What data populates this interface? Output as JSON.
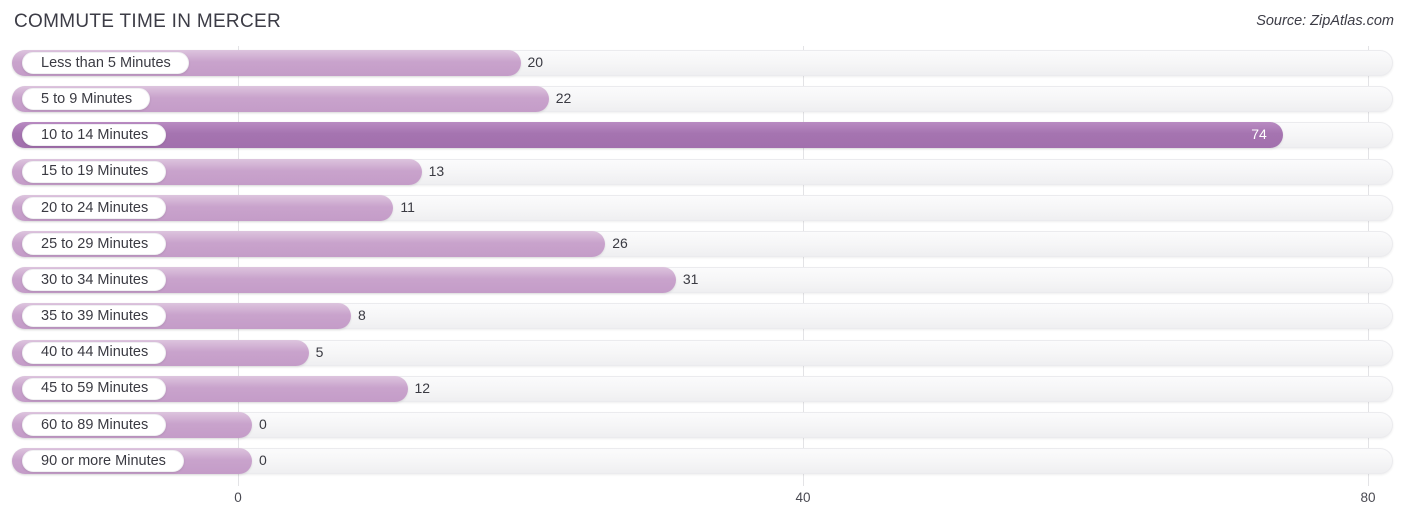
{
  "header": {
    "title": "COMMUTE TIME IN MERCER",
    "source": "Source: ZipAtlas.com"
  },
  "axis": {
    "ticks": [
      "0",
      "40",
      "80"
    ]
  },
  "chart_data": {
    "type": "bar",
    "orientation": "horizontal",
    "title": "COMMUTE TIME IN MERCER",
    "subtitle": "Source: ZipAtlas.com",
    "xlabel": "",
    "ylabel": "",
    "xlim": [
      0,
      80
    ],
    "xticks": [
      0,
      40,
      80
    ],
    "grid": true,
    "legend": false,
    "categories": [
      "Less than 5 Minutes",
      "5 to 9 Minutes",
      "10 to 14 Minutes",
      "15 to 19 Minutes",
      "20 to 24 Minutes",
      "25 to 29 Minutes",
      "30 to 34 Minutes",
      "35 to 39 Minutes",
      "40 to 44 Minutes",
      "45 to 59 Minutes",
      "60 to 89 Minutes",
      "90 or more Minutes"
    ],
    "values": [
      20,
      22,
      74,
      13,
      11,
      26,
      31,
      8,
      5,
      12,
      0,
      0
    ],
    "value_labels": [
      "20",
      "22",
      "74",
      "13",
      "11",
      "26",
      "31",
      "8",
      "5",
      "12",
      "0",
      "0"
    ],
    "colors": {
      "bar_light": "#c9a3cc",
      "bar_dark": "#a574b0",
      "track": "#f5f5f6",
      "text": "#3a3a42",
      "gridline": "#e3e3e6"
    },
    "highlight_index": 2
  },
  "rows": [
    {
      "label": "Less than 5 Minutes",
      "value": "20"
    },
    {
      "label": "5 to 9 Minutes",
      "value": "22"
    },
    {
      "label": "10 to 14 Minutes",
      "value": "74"
    },
    {
      "label": "15 to 19 Minutes",
      "value": "13"
    },
    {
      "label": "20 to 24 Minutes",
      "value": "11"
    },
    {
      "label": "25 to 29 Minutes",
      "value": "26"
    },
    {
      "label": "30 to 34 Minutes",
      "value": "31"
    },
    {
      "label": "35 to 39 Minutes",
      "value": "8"
    },
    {
      "label": "40 to 44 Minutes",
      "value": "5"
    },
    {
      "label": "45 to 59 Minutes",
      "value": "12"
    },
    {
      "label": "60 to 89 Minutes",
      "value": "0"
    },
    {
      "label": "90 or more Minutes",
      "value": "0"
    }
  ]
}
